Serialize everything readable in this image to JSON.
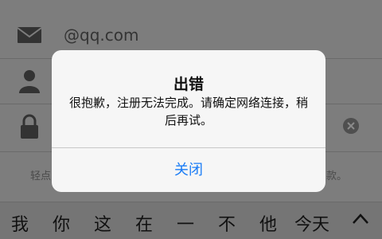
{
  "form": {
    "email_value": "@qq.com",
    "terms_hint_start": "轻点",
    "terms_hint_end": "款。"
  },
  "icons": {
    "email": "envelope-icon",
    "user": "person-icon",
    "password": "lock-icon",
    "clear": "clear-circle-icon",
    "expand": "chevron-up-icon"
  },
  "keyboard": {
    "candidates": [
      "我",
      "你",
      "这",
      "在",
      "一",
      "不",
      "他",
      "今天"
    ]
  },
  "alert": {
    "title": "出错",
    "message": "很抱歉，注册无法完成。请确定网络连接，稍后再试。",
    "button_label": "关闭"
  },
  "colors": {
    "dim_background": "#7d7d7d",
    "dialog_background": "#f6f6f6",
    "accent": "#1a7cf5"
  }
}
